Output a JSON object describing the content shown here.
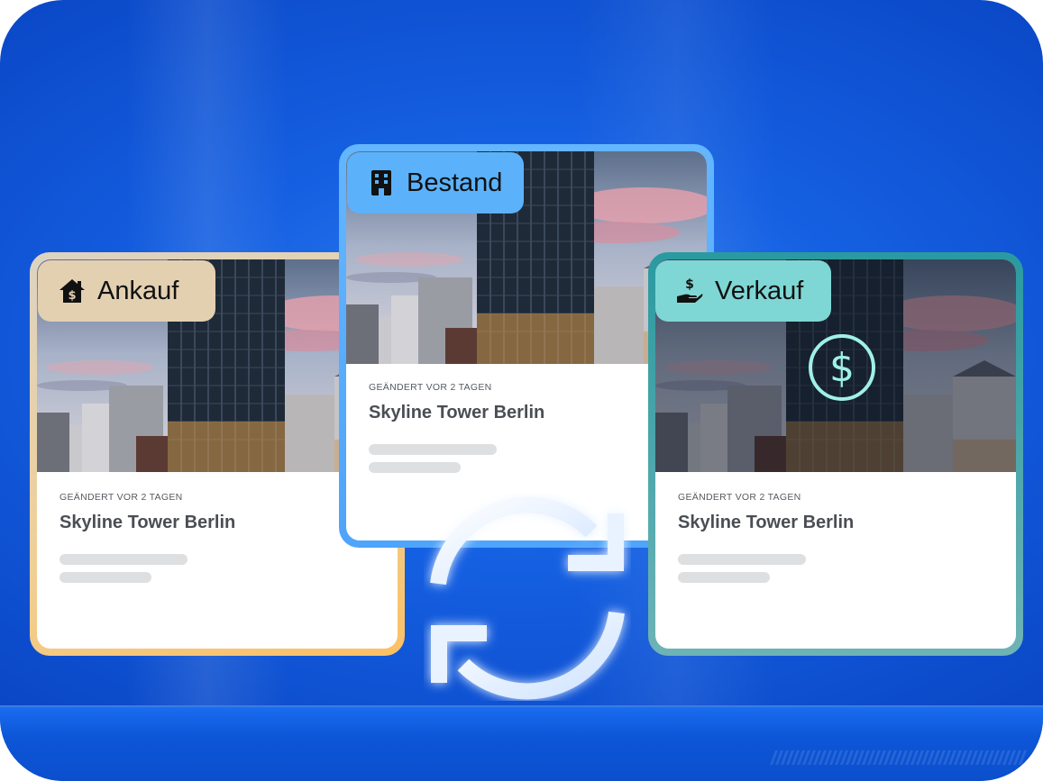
{
  "cards": {
    "ankauf": {
      "label": "Ankauf",
      "icon": "house-dollar-icon",
      "changed": "GEÄNDERT VOR 2 TAGEN",
      "title": "Skyline Tower Berlin",
      "accent": "#e3d0b1"
    },
    "bestand": {
      "label": "Bestand",
      "icon": "building-icon",
      "changed": "GEÄNDERT VOR 2 TAGEN",
      "title": "Skyline Tower Berlin",
      "accent": "#5bb2fb"
    },
    "verkauf": {
      "label": "Verkauf",
      "icon": "hand-dollar-icon",
      "changed": "GEÄNDERT VOR 2 TAGEN",
      "title": "Skyline Tower Berlin",
      "accent": "#7fd7d5",
      "badge_symbol": "$",
      "badge_icon": "dollar-circle-icon"
    }
  },
  "center_icon": "sync-arrows-icon",
  "colors": {
    "background": "#1560e2",
    "skeleton": "#dedfe1"
  }
}
